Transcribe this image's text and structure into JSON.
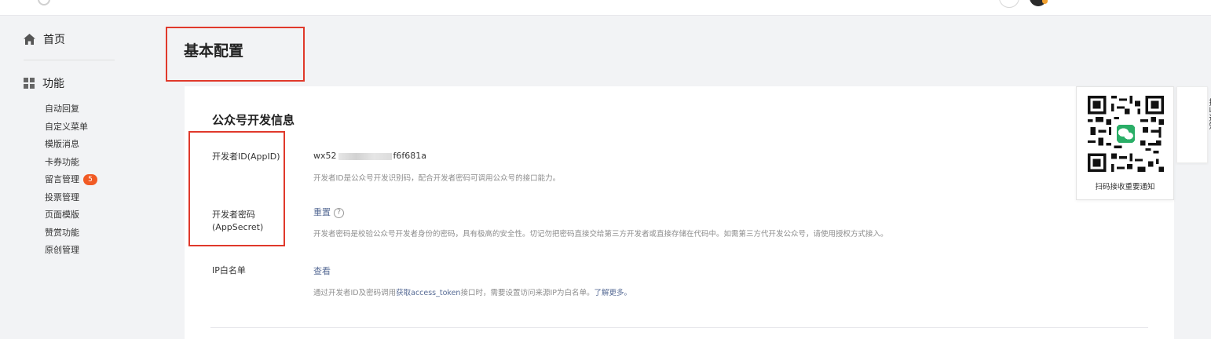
{
  "sidebar": {
    "home_label": "首页",
    "function_label": "功能",
    "items": [
      {
        "label": "自动回复"
      },
      {
        "label": "自定义菜单"
      },
      {
        "label": "模版消息"
      },
      {
        "label": "卡券功能"
      },
      {
        "label": "留言管理",
        "badge": "5"
      },
      {
        "label": "投票管理"
      },
      {
        "label": "页面模版"
      },
      {
        "label": "赞赏功能"
      },
      {
        "label": "原创管理"
      }
    ]
  },
  "page": {
    "title": "基本配置"
  },
  "dev_info": {
    "section_title": "公众号开发信息",
    "appid": {
      "label": "开发者ID(AppID)",
      "value_prefix": "wx52",
      "value_suffix": "f6f681a",
      "description": "开发者ID是公众号开发识别码，配合开发者密码可调用公众号的接口能力。"
    },
    "appsecret": {
      "label_line1": "开发者密码",
      "label_line2": "(AppSecret)",
      "action": "重置",
      "help": "?",
      "description": "开发者密码是校验公众号开发者身份的密码，具有极高的安全性。切记勿把密码直接交给第三方开发者或直接存储在代码中。如需第三方代开发公众号，请使用授权方式接入。"
    },
    "ip_whitelist": {
      "label": "IP白名单",
      "action": "查看",
      "desc_prefix": "通过开发者ID及密码调用",
      "desc_link": "获取access_token",
      "desc_middle": "接口时，需要设置访问来源IP为白名单。",
      "desc_more": "了解更多。"
    }
  },
  "qr_panel": {
    "caption": "扫码接收重要通知"
  },
  "side_tab": {
    "label": "接收通知"
  },
  "colors": {
    "accent_link": "#576b95",
    "highlight_border": "#e0392b",
    "badge": "#f15a24"
  }
}
